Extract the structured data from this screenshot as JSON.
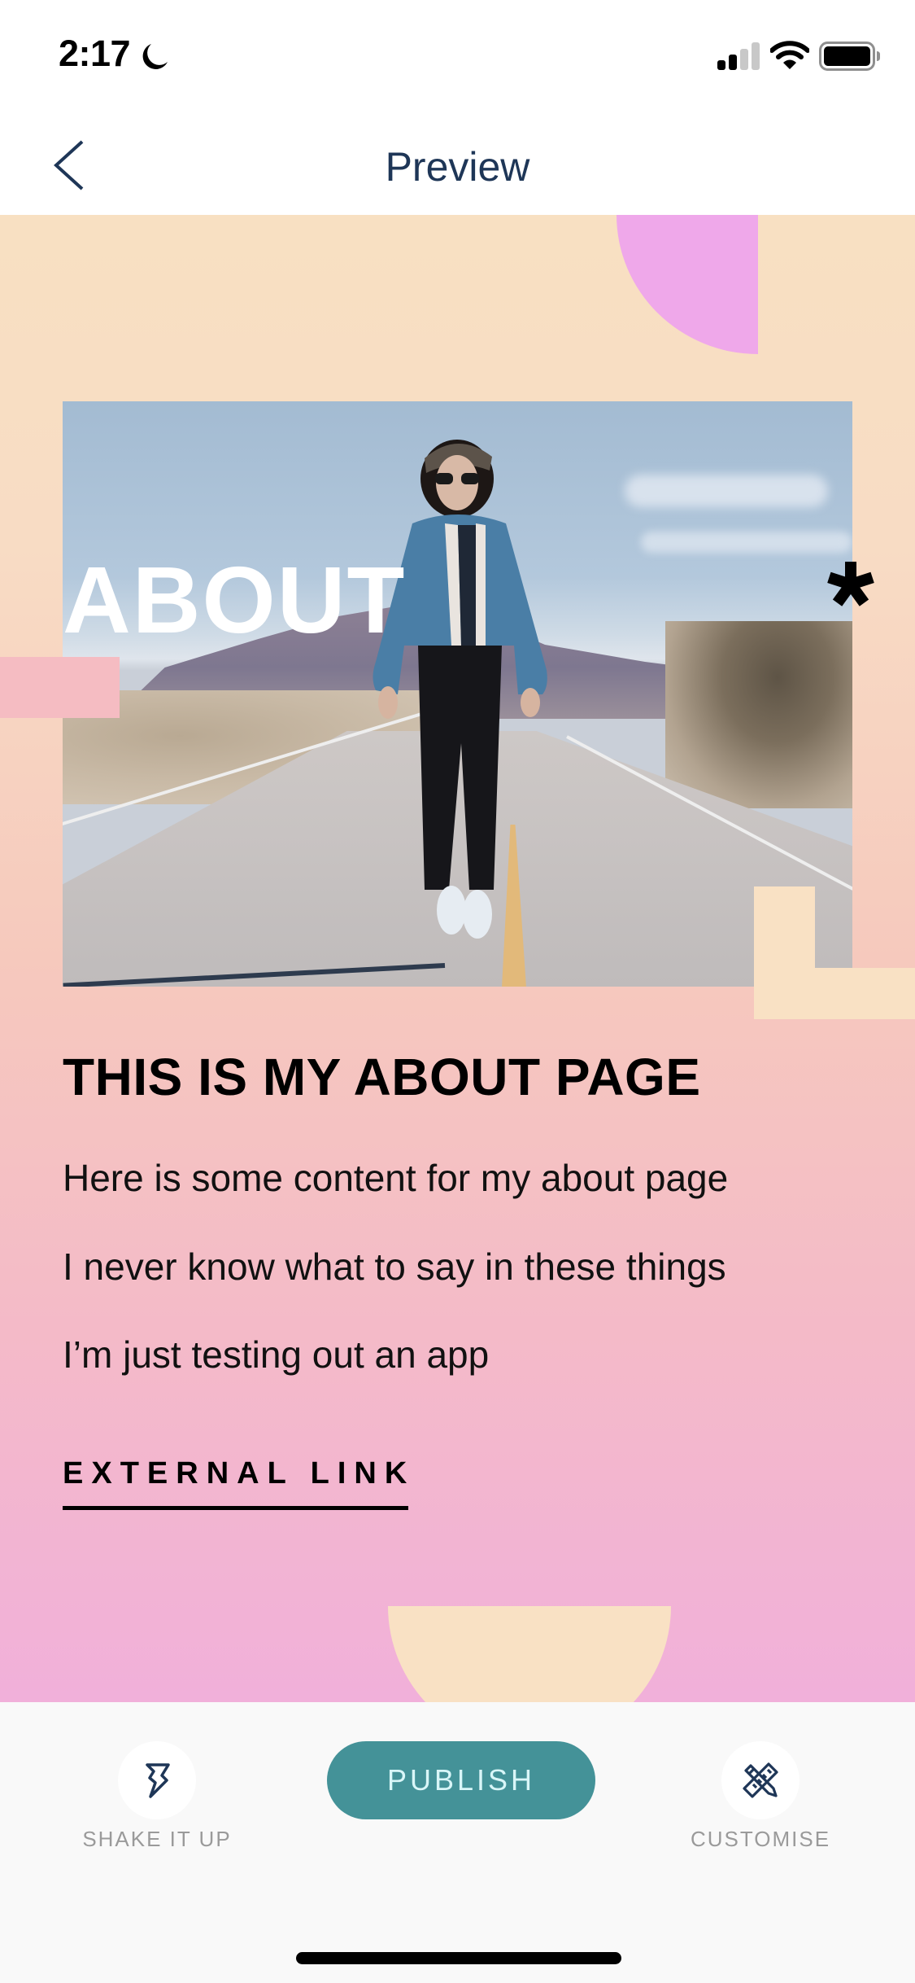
{
  "status_bar": {
    "time": "2:17",
    "focus_icon": "moon-icon",
    "signal_bars_active": 2,
    "signal_bars_total": 4,
    "wifi_icon": "wifi-icon",
    "battery_level": 1.0
  },
  "header": {
    "back_icon": "chevron-left-icon",
    "title": "Preview"
  },
  "preview": {
    "section_heading": "ABOUT",
    "decoration_glyph": "*",
    "photo_description": "Person in denim jacket and sunglasses walking down the center line of a desert road",
    "title": "THIS IS MY ABOUT PAGE",
    "paragraphs": [
      "Here is some content for my about page",
      "I never know what to say in these things",
      "I’m just testing out an app"
    ],
    "link_label": "EXTERNAL LINK"
  },
  "bottom_bar": {
    "shake": {
      "icon": "lightning-icon",
      "label": "SHAKE IT UP"
    },
    "publish": {
      "label": "PUBLISH"
    },
    "customise": {
      "icon": "pencil-ruler-icon",
      "label": "CUSTOMISE"
    }
  },
  "colors": {
    "nav_text": "#1e3657",
    "publish_bg": "#449298",
    "publish_text": "#d9f6f8",
    "gradient_top": "#f8e0c2",
    "gradient_mid": "#f6c9bd",
    "gradient_bottom": "#f1b0da",
    "accent_pink": "#efa8ea",
    "accent_cream": "#f9e1c4",
    "label_gray": "#9a9a9a"
  }
}
